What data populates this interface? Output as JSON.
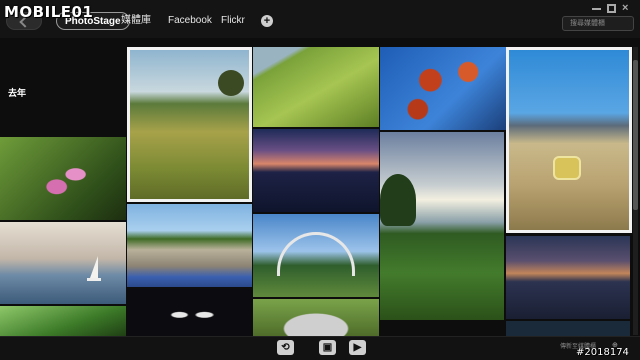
{
  "watermark": {
    "logo_text": "MOBILE01",
    "id": "#2018174"
  },
  "header": {
    "tabs": [
      {
        "label": "PhotoStage"
      },
      {
        "label": "媒體庫"
      },
      {
        "label": "Facebook"
      },
      {
        "label": "Flickr"
      }
    ],
    "add_tab": "+",
    "search_placeholder": "搜尋媒體櫃"
  },
  "window_controls": {
    "close": "×"
  },
  "library": {
    "year_label": "去年",
    "photos": [
      {
        "subject": "pink-flower"
      },
      {
        "subject": "sailboat"
      },
      {
        "subject": "green-leaves"
      },
      {
        "subject": "meadow"
      },
      {
        "subject": "bike-rider-bluebonnets"
      },
      {
        "subject": "car-headlights"
      },
      {
        "subject": "lawn-tree"
      },
      {
        "subject": "lake-sunset"
      },
      {
        "subject": "bridge"
      },
      {
        "subject": "koala"
      },
      {
        "subject": "red-leaves"
      },
      {
        "subject": "field-sunset"
      },
      {
        "subject": "yellow-chair"
      },
      {
        "subject": "city-skyline"
      }
    ]
  },
  "footer": {
    "rotate": "⟲",
    "slideshow": "▣",
    "play": "▶",
    "status_text": "傳新至媒體櫃",
    "zoom": "⊕"
  },
  "colors": {
    "background": "#0d0d0d",
    "selection_border": "#f2f2f2"
  }
}
